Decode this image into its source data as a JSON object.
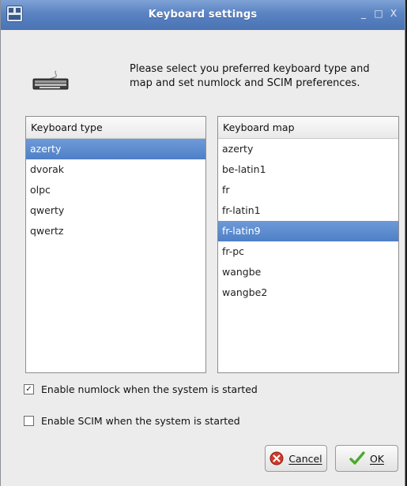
{
  "window": {
    "title": "Keyboard settings",
    "controls": {
      "minimize": "_",
      "maximize": "□",
      "close": "X"
    }
  },
  "instructions": "Please select you preferred keyboard type and map and set numlock and SCIM preferences.",
  "keyboard_type": {
    "header": "Keyboard type",
    "items": [
      "azerty",
      "dvorak",
      "olpc",
      "qwerty",
      "qwertz"
    ],
    "selected": "azerty"
  },
  "keyboard_map": {
    "header": "Keyboard map",
    "items": [
      "azerty",
      "be-latin1",
      "fr",
      "fr-latin1",
      "fr-latin9",
      "fr-pc",
      "wangbe",
      "wangbe2"
    ],
    "selected": "fr-latin9"
  },
  "options": {
    "numlock": {
      "label": "Enable numlock when the system is started",
      "checked": true
    },
    "scim": {
      "label": "Enable SCIM when the system is started",
      "checked": false
    }
  },
  "buttons": {
    "cancel": "Cancel",
    "ok": "OK"
  },
  "colors": {
    "titlebar": "#5a83c2",
    "selection": "#5a88cc",
    "cancel_icon": "#d03a2a",
    "ok_icon": "#4caa2e"
  },
  "icons": {
    "app": "keyboard-settings-app-icon",
    "illustration": "keyboard-icon",
    "cancel": "cancel-icon",
    "ok": "checkmark-icon"
  }
}
